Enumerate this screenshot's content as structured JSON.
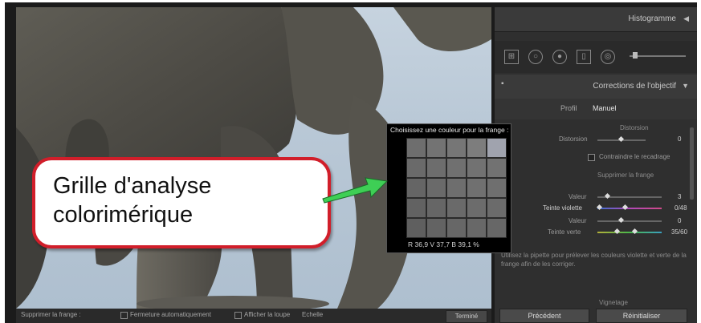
{
  "right_panel": {
    "histogram_title": "Histogramme",
    "lens_title": "Corrections de l'objectif",
    "tabs": [
      "Profil",
      "Manuel"
    ],
    "distortion_section": "Distorsion",
    "distortion_label": "Distorsion",
    "distortion_value": "0",
    "constrain_crop_label": "Contraindre le recadrage",
    "fringe_section": "Supprimer la frange",
    "rows": [
      {
        "label": "Valeur",
        "value": "3"
      },
      {
        "label": "Teinte violette",
        "value": "0/48"
      },
      {
        "label": "Valeur",
        "value": "0"
      },
      {
        "label": "Teinte verte",
        "value": "35/60"
      }
    ],
    "help_text": "Utilisez la pipette pour prélever les couleurs violette et verte de la frange afin de les corriger.",
    "vignetting_section": "Vignetage",
    "previous_button": "Précédent",
    "reset_button": "Réinitialiser"
  },
  "bottom_bar": {
    "label": "Supprimer la frange :",
    "auto_close_label": "Fermeture automatiquement",
    "show_loupe_label": "Afficher la loupe",
    "scale_label": "Echelle",
    "close_button": "Terminé"
  },
  "popup": {
    "title": "Choisissez une couleur pour la frange :",
    "values_text": "R 36,9   V 37,7   B 39,1  %",
    "cell_colors": [
      "#6e6e6e",
      "#737373",
      "#767676",
      "#7d7d7d",
      "#a0a3ae",
      "#6a6a6a",
      "#6d6d6d",
      "#707070",
      "#727272",
      "#727272",
      "#656565",
      "#6a6a6a",
      "#6e6e6e",
      "#707070",
      "#6f6f6f",
      "#626262",
      "#666666",
      "#6a6a6a",
      "#6c6c6c",
      "#6b6b6b",
      "#5f5f5f",
      "#636363",
      "#676767",
      "#686868",
      "#676767"
    ]
  },
  "callout": {
    "line1": "Grille d'analyse",
    "line2": "colorimérique",
    "border_color": "#d11e2a",
    "arrow_color": "#3ecf55"
  }
}
